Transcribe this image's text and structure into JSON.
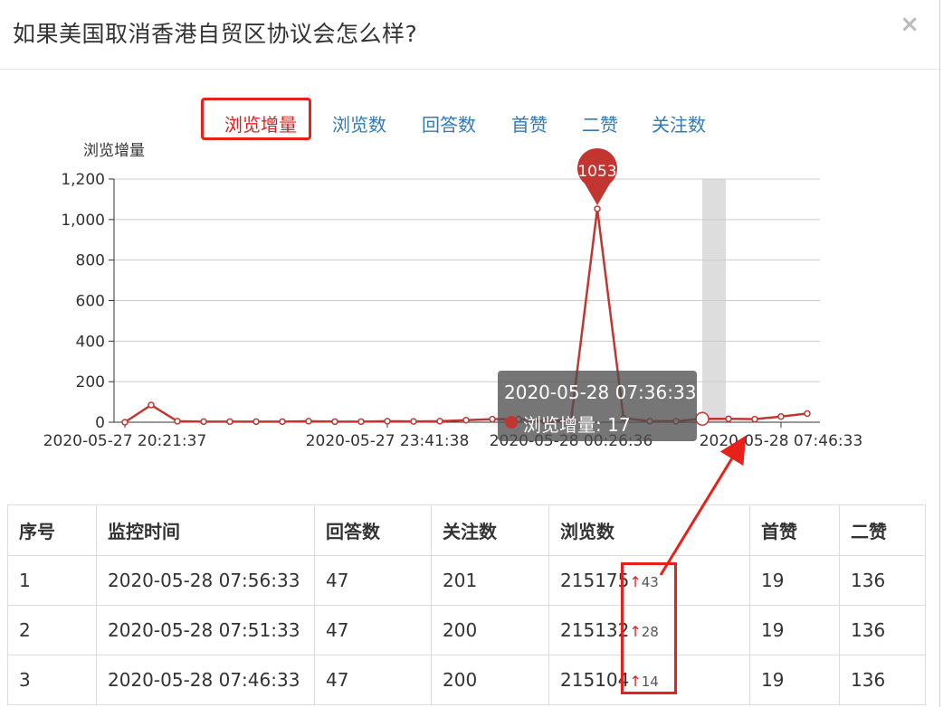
{
  "modal": {
    "title": "如果美国取消香港自贸区协议会怎么样?",
    "close_icon": "close-icon"
  },
  "tabs": [
    {
      "label": "浏览增量",
      "active": true
    },
    {
      "label": "浏览数",
      "active": false
    },
    {
      "label": "回答数",
      "active": false
    },
    {
      "label": "首赞",
      "active": false
    },
    {
      "label": "二赞",
      "active": false
    },
    {
      "label": "关注数",
      "active": false
    }
  ],
  "chart_data": {
    "type": "line",
    "ylabel": "浏览增量",
    "ylim": [
      0,
      1200
    ],
    "yticks": [
      "0",
      "200",
      "400",
      "600",
      "800",
      "1,000",
      "1,200"
    ],
    "xtick_labels": [
      "2020-05-27 20:21:37",
      "2020-05-27 23:41:38",
      "2020-05-28 00:26:36",
      "2020-05-28 07:46:33"
    ],
    "series": [
      {
        "name": "浏览增量",
        "color": "#c23531",
        "values": [
          0,
          85,
          5,
          3,
          3,
          3,
          3,
          5,
          3,
          3,
          5,
          4,
          5,
          10,
          15,
          15,
          5,
          10,
          1053,
          20,
          5,
          5,
          17,
          17,
          15,
          28,
          43
        ]
      }
    ],
    "max_marker": {
      "value": "1053"
    },
    "grid": true
  },
  "tooltip": {
    "time": "2020-05-28 07:36:33",
    "series_name": "浏览增量",
    "value": "17"
  },
  "table": {
    "headers": [
      "序号",
      "监控时间",
      "回答数",
      "关注数",
      "浏览数",
      "首赞",
      "二赞"
    ],
    "rows": [
      {
        "no": "1",
        "time": "2020-05-28 07:56:33",
        "answers": "47",
        "follows": "201",
        "views": "215175",
        "delta": "43",
        "like1": "19",
        "like2": "136"
      },
      {
        "no": "2",
        "time": "2020-05-28 07:51:33",
        "answers": "47",
        "follows": "200",
        "views": "215132",
        "delta": "28",
        "like1": "19",
        "like2": "136"
      },
      {
        "no": "3",
        "time": "2020-05-28 07:46:33",
        "answers": "47",
        "follows": "200",
        "views": "215104",
        "delta": "14",
        "like1": "19",
        "like2": "136"
      }
    ],
    "up_arrow": "↑"
  },
  "colors": {
    "accent": "#c23531",
    "link": "#337ab7",
    "highlight": "#e8201a"
  }
}
